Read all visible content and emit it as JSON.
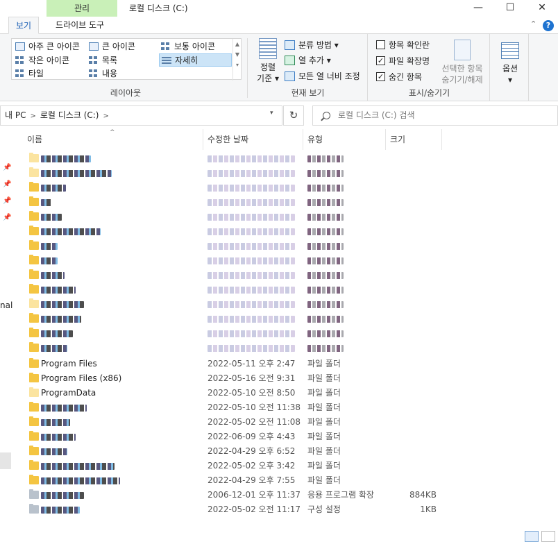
{
  "window": {
    "context_tab": "관리",
    "title": "로컬 디스크 (C:)",
    "controls": {
      "minimize": "—",
      "maximize": "☐",
      "close": "✕"
    }
  },
  "ribbon_tabs": [
    {
      "label": "보기"
    },
    {
      "label": "드라이브 도구"
    }
  ],
  "ribbon": {
    "collapse": "⌃",
    "help": "?",
    "layout": {
      "items": [
        {
          "label": "아주 큰 아이콘"
        },
        {
          "label": "큰 아이콘"
        },
        {
          "label": "보통 아이콘"
        },
        {
          "label": "작은 아이콘"
        },
        {
          "label": "목록"
        },
        {
          "label": "자세히"
        },
        {
          "label": "타일"
        },
        {
          "label": "내용"
        }
      ],
      "group_label": "레이아웃"
    },
    "current_view": {
      "sort": {
        "label_1": "정렬",
        "label_2": "기준"
      },
      "group_by": "분류 방법",
      "add_columns": "열 추가",
      "fit_columns": "모든 열 너비 조정",
      "group_label": "현재 보기"
    },
    "show_hide": {
      "item_checkboxes": {
        "label": "항목 확인란",
        "checked": false
      },
      "file_extensions": {
        "label": "파일 확장명",
        "checked": true
      },
      "hidden_items": {
        "label": "숨긴 항목",
        "checked": true
      },
      "hide_selected": {
        "line_1": "선택한 항목",
        "line_2": "숨기기/해제"
      },
      "group_label": "표시/숨기기"
    },
    "options": {
      "label": "옵션"
    }
  },
  "address": {
    "crumbs": [
      "내 PC",
      "로컬 디스크 (C:)"
    ],
    "refresh": "↻",
    "search_placeholder": "로컬 디스크 (C:) 검색"
  },
  "nav": {
    "partial_text": "nal"
  },
  "columns": {
    "name": "이름",
    "modified": "수정한 날짜",
    "type": "유형",
    "size": "크기"
  },
  "files": [
    {
      "name": "Program Files",
      "date": "2022-05-11 오후 2:47",
      "type": "파일 폴더",
      "size": ""
    },
    {
      "name": "Program Files (x86)",
      "date": "2022-05-16 오전 9:31",
      "type": "파일 폴더",
      "size": ""
    },
    {
      "name": "ProgramData",
      "date": "2022-05-10 오전 8:50",
      "type": "파일 폴더",
      "size": ""
    },
    {
      "name": "",
      "date": "2022-05-10 오전 11:38",
      "type": "파일 폴더",
      "size": ""
    },
    {
      "name": "",
      "date": "2022-05-02 오전 11:08",
      "type": "파일 폴더",
      "size": ""
    },
    {
      "name": "",
      "date": "2022-06-09 오후 4:43",
      "type": "파일 폴더",
      "size": ""
    },
    {
      "name": "",
      "date": "2022-04-29 오후 6:52",
      "type": "파일 폴더",
      "size": ""
    },
    {
      "name": "",
      "date": "2022-05-02 오후 3:42",
      "type": "파일 폴더",
      "size": ""
    },
    {
      "name": "",
      "date": "2022-04-29 오후 7:55",
      "type": "파일 폴더",
      "size": ""
    },
    {
      "name": "",
      "date": "2006-12-01 오후 11:37",
      "type": "응용 프로그램 확장",
      "size": "884KB"
    },
    {
      "name": "",
      "date": "2022-05-02 오전 11:17",
      "type": "구성 설정",
      "size": "1KB"
    }
  ]
}
